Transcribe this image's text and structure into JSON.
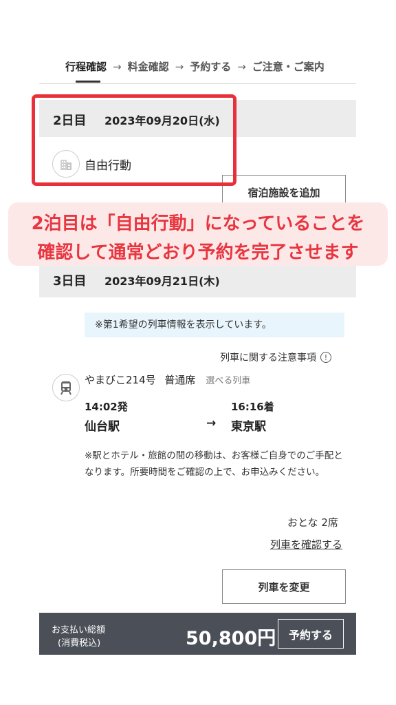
{
  "steps": [
    {
      "label": "行程確認",
      "active": true
    },
    {
      "label": "料金確認",
      "active": false
    },
    {
      "label": "予約する",
      "active": false
    },
    {
      "label": "ご注意・ご案内",
      "active": false
    }
  ],
  "step_arrow": "→",
  "day2": {
    "label": "2日目",
    "date": "2023年09月20日(水)",
    "activity": "自由行動"
  },
  "add_lodging_button": "宿泊施設を追加",
  "annotation": {
    "line1": "2泊目は「自由行動」になっていることを",
    "line2": "確認して通常どおり予約を完了させます",
    "color": "#e8303a"
  },
  "day3": {
    "label": "3日目",
    "date": "2023年09月21日(木)"
  },
  "train_notice": "※第1希望の列車情報を表示しています。",
  "train_caution_link": "列車に関する注意事項",
  "train": {
    "name": "やまびこ214号",
    "seat_class": "普通席",
    "selectable": "選べる列車",
    "depart_time": "14:02発",
    "arrive_time": "16:16着",
    "from_station": "仙台駅",
    "to_station": "東京駅",
    "arrow": "→"
  },
  "transfer_note": "※駅とホテル・旅館の間の移動は、お客様ご自身でのご手配となります。所要時間をご確認の上で、お申込みください。",
  "passengers": "おとな 2席",
  "confirm_train_link": "列車を確認する",
  "change_train_button": "列車を変更",
  "footer": {
    "total_label": "お支払い総額",
    "tax_label": "(消費税込)",
    "amount": "50,800円",
    "reserve_button": "予約する"
  }
}
